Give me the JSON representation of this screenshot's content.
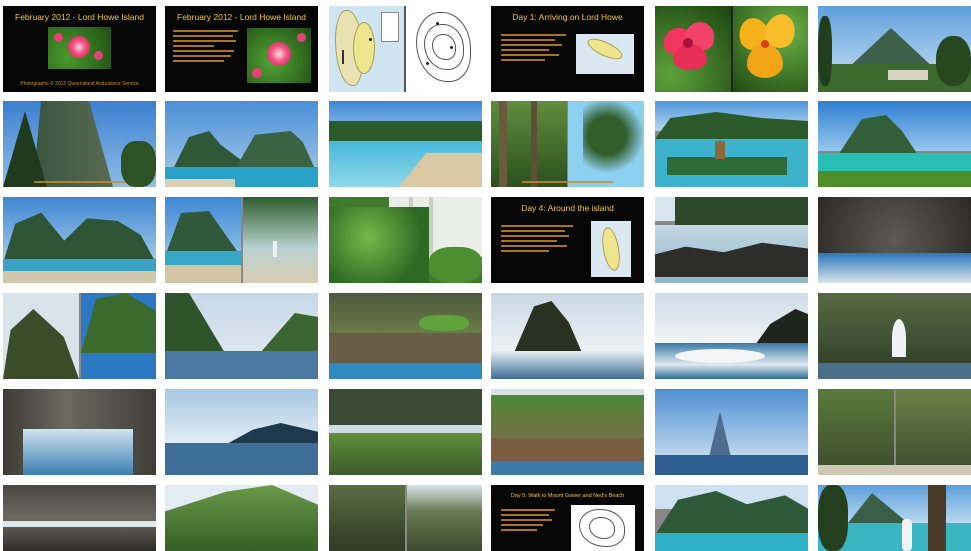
{
  "viewer": {
    "title_slide_1": "February 2012 - Lord Howe Island",
    "title_slide_1_caption": "Photographs © 2012 Queensland Ambulance Service",
    "title_slide_2": "February 2012 - Lord Howe Island",
    "title_slide_3": "Day 1: Arriving on Lord Howe",
    "title_slide_4": "Day 4: Around the island",
    "title_slide_5": "Day 5: Walk to Mount Gower and Ned's Beach"
  },
  "colors": {
    "slide_background": "#060606",
    "slide_title": "#f0c63a",
    "slide_text": "#c88a1e",
    "sky": "#4b8fd6",
    "sea": "#2aa7c9",
    "cliff": "#2f5d3a"
  },
  "tiles": [
    {
      "name": "thumb-title-slide",
      "kind": "slide"
    },
    {
      "name": "thumb-intro-slide",
      "kind": "slide"
    },
    {
      "name": "thumb-island-maps",
      "kind": "map"
    },
    {
      "name": "thumb-day1-slide",
      "kind": "slide"
    },
    {
      "name": "thumb-flowers",
      "kind": "photo"
    },
    {
      "name": "thumb-mount-view",
      "kind": "photo"
    }
  ]
}
